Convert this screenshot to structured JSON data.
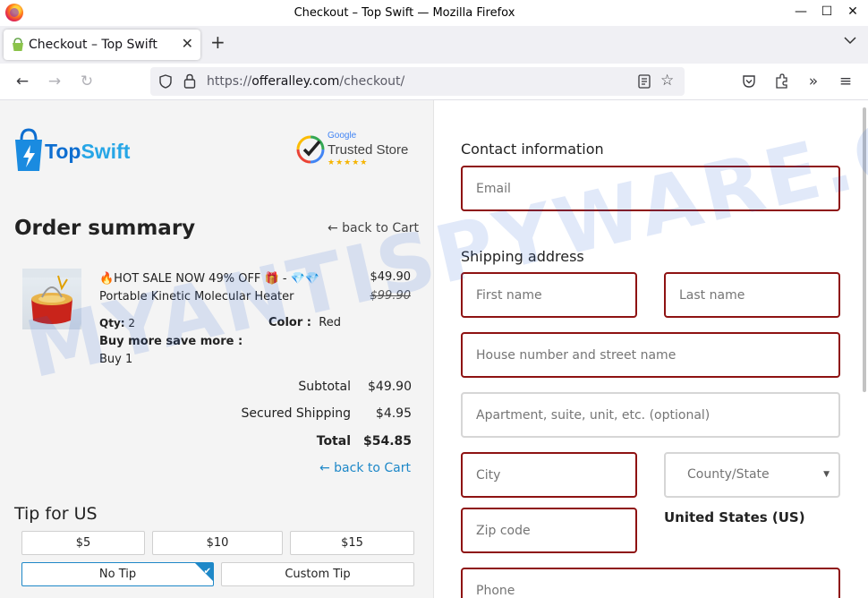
{
  "window": {
    "title": "Checkout – Top Swift — Mozilla Firefox"
  },
  "tab": {
    "label": "Checkout – Top Swift"
  },
  "url": {
    "scheme": "https://",
    "host": "offeralley.com",
    "path": "/checkout/"
  },
  "brand": {
    "name_part1": "Top",
    "name_part2": "Swift"
  },
  "trust_badge": {
    "google": "Google",
    "label": "Trusted Store",
    "stars": "★★★★★"
  },
  "order_summary": {
    "title": "Order summary",
    "back_to_cart": "← back to Cart",
    "product": {
      "name_line1": "🔥HOT SALE NOW 49% OFF 🎁 - 💎💎",
      "name_line2": "Portable Kinetic Molecular Heater",
      "price": "$49.90",
      "compare_price": "$99.90",
      "qty_label": "Qty:",
      "qty": "2",
      "color_label": "Color :",
      "color": "Red",
      "buy_more_label": "Buy more save more :",
      "buy_more_value": "Buy 1"
    },
    "totals": [
      {
        "label": "Subtotal",
        "value": "$49.90"
      },
      {
        "label": "Secured Shipping",
        "value": "$4.95"
      },
      {
        "label": "Total",
        "value": "$54.85"
      }
    ],
    "back_to_cart_bottom": "← back to Cart"
  },
  "tip": {
    "title": "Tip for US",
    "options": [
      "$5",
      "$10",
      "$15"
    ],
    "no_tip": "No Tip",
    "custom_tip": "Custom Tip"
  },
  "contact": {
    "title": "Contact information",
    "email_placeholder": "Email"
  },
  "shipping": {
    "title": "Shipping address",
    "first_name": "First name",
    "last_name": "Last name",
    "address1": "House number and street name",
    "address2": "Apartment, suite, unit, etc. (optional)",
    "city": "City",
    "state": "County/State",
    "zip": "Zip code",
    "country": "United States (US)",
    "phone": "Phone"
  },
  "watermark": "MYANTISPYWARE.COM",
  "colors": {
    "error_border": "#8e1212",
    "accent": "#1e88c8",
    "brand_blue": "#0e6ed0"
  }
}
